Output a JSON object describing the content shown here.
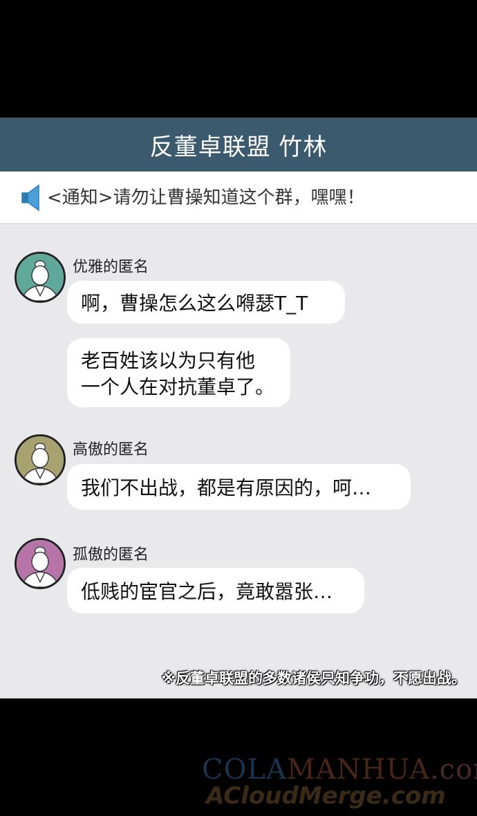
{
  "header": {
    "title": "反董卓联盟 竹林"
  },
  "notice": {
    "icon": "speaker-icon",
    "text": "<通知>请勿让曹操知道这个群，嘿嘿！"
  },
  "messages": [
    {
      "sender": "优雅的匿名",
      "avatar_color": "#5fa89a",
      "bubbles": [
        "啊，曹操怎么这么嘚瑟T_T",
        "老百姓该以为只有他",
        "一个人在对抗董卓了。"
      ]
    },
    {
      "sender": "高傲的匿名",
      "avatar_color": "#a8a270",
      "bubbles": [
        "我们不出战，都是有原因的，呵…"
      ]
    },
    {
      "sender": "孤傲的匿名",
      "avatar_color": "#b774a8",
      "bubbles": [
        "低贱的宦官之后，竟敢嚣张…"
      ]
    }
  ],
  "footnote": "※反董卓联盟的多数诸侯只知争功，不愿出战。",
  "watermark": {
    "line1_a": "COLA",
    "line1_b": "MANHUA",
    "line1_c": ".com",
    "line2": "ACloudMerge.com"
  }
}
